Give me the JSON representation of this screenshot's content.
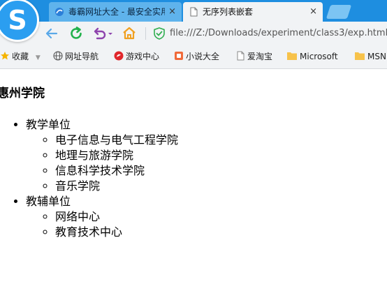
{
  "browser": {
    "logo_glyph": "S",
    "tabs": [
      {
        "label": "毒霸网址大全 - 最安全实用的网址导航",
        "close": "×",
        "active": false
      },
      {
        "label": "无序列表嵌套",
        "close": "×",
        "active": true
      }
    ],
    "address": "file:///Z:/Downloads/experiment/class3/exp.html",
    "bookmarks": [
      {
        "label": "收藏",
        "icon": "star-icon"
      },
      {
        "label": "网址导航",
        "icon": "globe-icon"
      },
      {
        "label": "游戏中心",
        "icon": "game-icon"
      },
      {
        "label": "小说大全",
        "icon": "book-icon"
      },
      {
        "label": "爱淘宝",
        "icon": "page-icon"
      },
      {
        "label": "Microsoft",
        "icon": "folder-icon"
      },
      {
        "label": "MSN",
        "icon": "folder-icon"
      }
    ],
    "colors": {
      "tabstrip": "#1e8ee0",
      "toolbar": "#f1f3f5",
      "reload": "#22b14c",
      "undo": "#8e44ad",
      "home": "#f0a020"
    }
  },
  "page": {
    "title": "惠州学院",
    "groups": [
      {
        "label": "教学单位",
        "items": [
          "电子信息与电气工程学院",
          "地理与旅游学院",
          "信息科学技术学院",
          "音乐学院"
        ]
      },
      {
        "label": "教辅单位",
        "items": [
          "网络中心",
          "教育技术中心"
        ]
      }
    ]
  }
}
